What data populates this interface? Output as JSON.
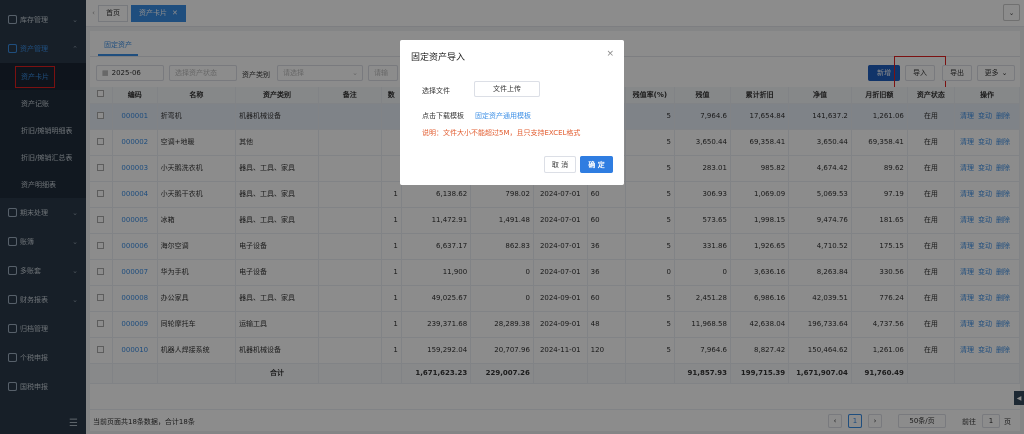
{
  "sidebar": {
    "groups": [
      {
        "label": "库存管理",
        "icon": "box-icon",
        "expanded": false
      },
      {
        "label": "资产管理",
        "icon": "asset-icon",
        "expanded": true
      }
    ],
    "sub_items": [
      "资产卡片",
      "资产记账",
      "折旧/摊销明细表",
      "折旧/摊销汇总表",
      "资产明细表"
    ],
    "more_groups": [
      {
        "label": "期末处理",
        "icon": "calendar-icon"
      },
      {
        "label": "账簿",
        "icon": "book-icon"
      },
      {
        "label": "多账套",
        "icon": "stack-icon"
      },
      {
        "label": "财务报表",
        "icon": "report-icon"
      },
      {
        "label": "归档管理",
        "icon": "archive-icon"
      },
      {
        "label": "个税申报",
        "icon": "tax-icon"
      },
      {
        "label": "国税申报",
        "icon": "national-tax-icon"
      }
    ],
    "collapse_glyph": "☰"
  },
  "tabs": [
    {
      "label": "首页"
    },
    {
      "label": "资产卡片",
      "close": "✕"
    }
  ],
  "subtab": "固定资产",
  "filters": {
    "period": "2025-06",
    "status_placeholder": "选择资产状态",
    "type_label": "资产类别",
    "type_placeholder": "请选择",
    "search_placeholder": "请输"
  },
  "toolbar": {
    "add": "新增",
    "import": "导入",
    "export": "导出",
    "more": "更多"
  },
  "table": {
    "headers": [
      "编码",
      "名称",
      "资产类别",
      "备注",
      "数",
      "",
      "",
      "",
      "",
      "残值率(%)",
      "残值",
      "累计折旧",
      "净值",
      "月折旧额",
      "资产状态",
      "操作"
    ],
    "rows": [
      [
        "000001",
        "折弯机",
        "机器机械设备",
        "",
        "",
        "",
        "",
        "",
        "",
        "5",
        "7,964.6",
        "17,654.84",
        "141,637.2",
        "1,261.06",
        "在用"
      ],
      [
        "000002",
        "空调+地暖",
        "其他",
        "",
        "",
        "",
        "",
        "",
        "",
        "5",
        "3,650.44",
        "69,358.41",
        "3,650.44",
        "69,358.41",
        "在用"
      ],
      [
        "000003",
        "小天鹅洗衣机",
        "器具、工具、家具",
        "",
        "",
        "",
        "",
        "",
        "",
        "5",
        "283.01",
        "985.82",
        "4,674.42",
        "89.62",
        "在用"
      ],
      [
        "000004",
        "小天鹅干衣机",
        "器具、工具、家具",
        "",
        "1",
        "6,138.62",
        "798.02",
        "2024-07-01",
        "60",
        "5",
        "306.93",
        "1,069.09",
        "5,069.53",
        "97.19",
        "在用"
      ],
      [
        "000005",
        "冰箱",
        "器具、工具、家具",
        "",
        "1",
        "11,472.91",
        "1,491.48",
        "2024-07-01",
        "60",
        "5",
        "573.65",
        "1,998.15",
        "9,474.76",
        "181.65",
        "在用"
      ],
      [
        "000006",
        "海尔空调",
        "电子设备",
        "",
        "1",
        "6,637.17",
        "862.83",
        "2024-07-01",
        "36",
        "5",
        "331.86",
        "1,926.65",
        "4,710.52",
        "175.15",
        "在用"
      ],
      [
        "000007",
        "华为手机",
        "电子设备",
        "",
        "1",
        "11,900",
        "0",
        "2024-07-01",
        "36",
        "0",
        "0",
        "3,636.16",
        "8,263.84",
        "330.56",
        "在用"
      ],
      [
        "000008",
        "办公家具",
        "器具、工具、家具",
        "",
        "1",
        "49,025.67",
        "0",
        "2024-09-01",
        "60",
        "5",
        "2,451.28",
        "6,986.16",
        "42,039.51",
        "776.24",
        "在用"
      ],
      [
        "000009",
        "同轮摩托车",
        "运输工具",
        "",
        "1",
        "239,371.68",
        "28,289.38",
        "2024-09-01",
        "48",
        "5",
        "11,968.58",
        "42,638.04",
        "196,733.64",
        "4,737.56",
        "在用"
      ],
      [
        "000010",
        "机器人焊接系统",
        "机器机械设备",
        "",
        "1",
        "159,292.04",
        "20,707.96",
        "2024-11-01",
        "120",
        "5",
        "7,964.6",
        "8,827.42",
        "150,464.62",
        "1,261.06",
        "在用"
      ]
    ],
    "ops": [
      "清理",
      "变动",
      "删除"
    ],
    "totals": {
      "label": "合计",
      "orig": "1,671,623.23",
      "init": "229,007.26",
      "residual": "91,857.93",
      "accum": "199,715.39",
      "net": "1,671,907.04",
      "monthly": "91,760.49"
    }
  },
  "pager": {
    "info": "当前页面共18条数据，合计18条",
    "prev": "‹",
    "page": "1",
    "next": "›",
    "per_page": "50条/页",
    "goto_label": "前往",
    "goto_value": "1",
    "unit": "页"
  },
  "modal": {
    "title": "固定资产导入",
    "close": "×",
    "file_label": "选择文件",
    "upload_btn": "文件上传",
    "template_label": "点击下载模板",
    "template_link": "固定资产通用模板",
    "note": "说明：文件大小不能超过5M，且只支持EXCEL格式",
    "cancel": "取 消",
    "ok": "确 定"
  }
}
